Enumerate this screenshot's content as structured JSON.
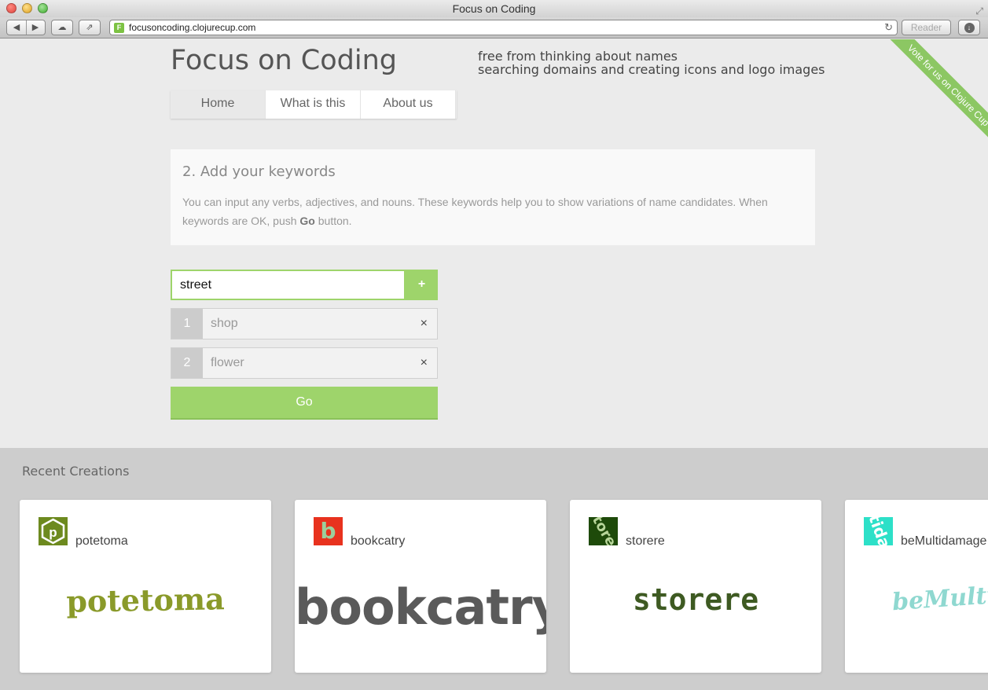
{
  "browser": {
    "window_title": "Focus on Coding",
    "url": "focusoncoding.clojurecup.com",
    "reader_label": "Reader"
  },
  "site": {
    "title": "Focus on Coding",
    "tagline_line1": "free from thinking about names",
    "tagline_line2": "searching domains and creating icons and logo images",
    "ribbon": "Vote for us on Clojure Cup !"
  },
  "nav": {
    "tabs": [
      {
        "label": "Home",
        "active": true
      },
      {
        "label": "What is this",
        "active": false
      },
      {
        "label": "About us",
        "active": false
      }
    ]
  },
  "step": {
    "heading": "2. Add your keywords",
    "body_before": "You can input any verbs, adjectives, and nouns. These keywords help you to show variations of name candidates. When keywords are OK, push ",
    "body_bold": "Go",
    "body_after": " button."
  },
  "keyword_input": {
    "value": "street",
    "add_label": "+"
  },
  "keywords": [
    {
      "num": "1",
      "text": "shop",
      "remove": "×"
    },
    {
      "num": "2",
      "text": "flower",
      "remove": "×"
    }
  ],
  "go_label": "Go",
  "recent": {
    "heading": "Recent Creations",
    "cards": [
      {
        "name": "potetoma",
        "icon_glyph": "p",
        "icon_color": "#6d8a1f",
        "logo_text": "potetoma",
        "logo_color": "#8a9a2a"
      },
      {
        "name": "bookcatry",
        "icon_glyph": "b",
        "icon_color": "#e8321e",
        "logo_text": "bookcatry",
        "logo_color": "#5a5a5a"
      },
      {
        "name": "storere",
        "icon_glyph": "tore",
        "icon_color": "#1e4a0a",
        "logo_text": "storere",
        "logo_color": "#3e5a22"
      },
      {
        "name": "beMultidamage",
        "icon_glyph": "tida",
        "icon_color": "#2de0c8",
        "logo_text": "beMultid",
        "logo_color": "#8fd8d0"
      }
    ]
  }
}
